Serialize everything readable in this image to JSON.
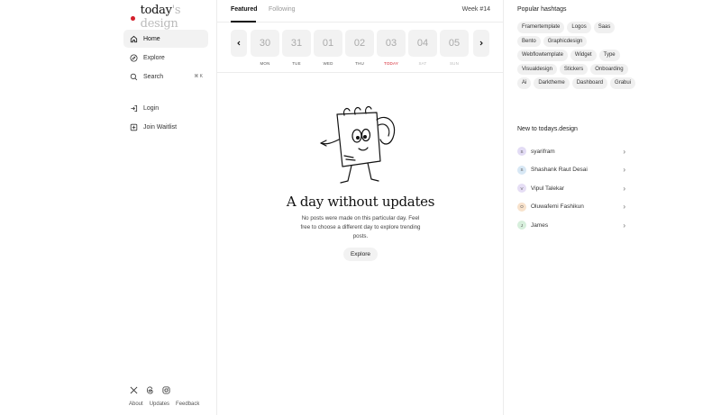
{
  "logo": {
    "part1": "today",
    "part2": "'s design"
  },
  "nav": {
    "home": "Home",
    "explore": "Explore",
    "search": "Search",
    "search_kbd": "⌘ K",
    "login": "Login",
    "waitlist": "Join Waitlist"
  },
  "footer": {
    "about": "About",
    "updates": "Updates",
    "feedback": "Feedback"
  },
  "tabs": {
    "featured": "Featured",
    "following": "Following",
    "week": "Week #14"
  },
  "days": [
    {
      "num": "30",
      "label": "MON",
      "state": "normal"
    },
    {
      "num": "31",
      "label": "TUE",
      "state": "normal"
    },
    {
      "num": "01",
      "label": "WED",
      "state": "normal"
    },
    {
      "num": "02",
      "label": "THU",
      "state": "normal"
    },
    {
      "num": "03",
      "label": "TODAY",
      "state": "today"
    },
    {
      "num": "04",
      "label": "SAT",
      "state": "muted"
    },
    {
      "num": "05",
      "label": "SUN",
      "state": "muted"
    }
  ],
  "empty": {
    "title": "A day without updates",
    "text": "No posts were made on this particular day. Feel free to choose a different day to explore trending posts.",
    "button": "Explore"
  },
  "right": {
    "hashtags_title": "Popular hashtags",
    "hashtags": [
      "Framertemplate",
      "Logos",
      "Saas",
      "Bento",
      "Graphicdesign",
      "Webflowtemplate",
      "Widget",
      "Type",
      "Visualdesign",
      "Stickers",
      "Onboarding",
      "Ai",
      "Darktheme",
      "Dashboard",
      "Grabui"
    ],
    "new_title": "New to todays.design",
    "users": [
      {
        "initial": "S",
        "name": "syarifram",
        "color": "#e3dcf5"
      },
      {
        "initial": "S",
        "name": "Shashank Raut Desai",
        "color": "#d8e8f5"
      },
      {
        "initial": "V",
        "name": "Vipul Talekar",
        "color": "#e6def5"
      },
      {
        "initial": "O",
        "name": "Oluwafemi Fashikun",
        "color": "#f8e2cc"
      },
      {
        "initial": "J",
        "name": "James",
        "color": "#d7efdc"
      }
    ]
  }
}
